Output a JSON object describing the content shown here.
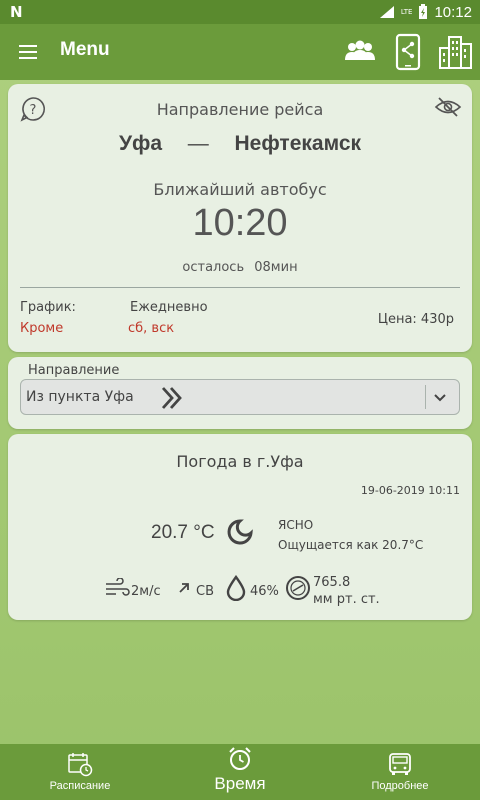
{
  "status_bar": {
    "time": "10:12",
    "network": "LTE",
    "battery_icon": "battery-charging-icon",
    "logo": "N"
  },
  "app_bar": {
    "title": "Menu"
  },
  "route_card": {
    "heading": "Направление рейса",
    "from_city": "Уфа",
    "dash": "—",
    "to_city": "Нефтекамск",
    "next_bus_label": "Ближайший автобус",
    "next_bus_time": "10:20",
    "remaining_label": "осталось",
    "remaining_value": "08мин",
    "schedule_label": "График:",
    "schedule_value": "Ежедневно",
    "except_label": "Кроме",
    "except_value": "сб, вск",
    "price": "Цена: 430р"
  },
  "direction_card": {
    "label": "Направление",
    "selected": "Из пункта Уфа"
  },
  "weather_card": {
    "heading": "Погода в г.Уфа",
    "datetime": "19-06-2019 10:11",
    "temperature": "20.7 °C",
    "condition": "ЯСНО",
    "feels_like": "Ощущается как 20.7°C",
    "wind_speed": "2м/с",
    "wind_dir": "СВ",
    "humidity": "46%",
    "pressure_value": "765.8",
    "pressure_unit": "мм рт. ст."
  },
  "bottom_nav": {
    "items": [
      {
        "label": "Расписание",
        "icon": "calendar-clock-icon"
      },
      {
        "label": "Время",
        "icon": "alarm-clock-icon"
      },
      {
        "label": "Подробнее",
        "icon": "bus-icon"
      }
    ]
  },
  "colors": {
    "accent_green": "#6b9b3b",
    "status_green": "#5a8a2e",
    "card_bg": "#e8f0e3",
    "red_text": "#c0392b"
  }
}
